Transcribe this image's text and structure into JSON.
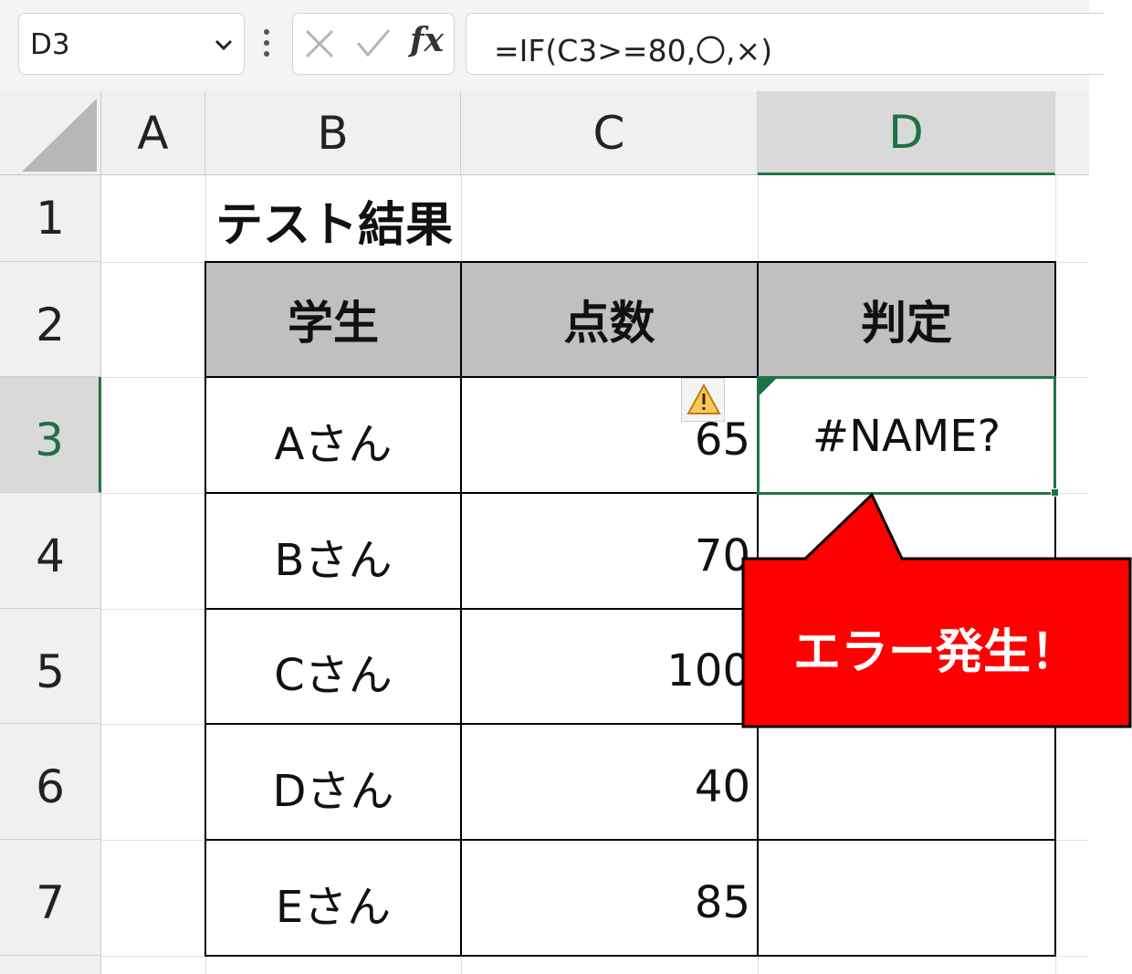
{
  "formula_bar": {
    "name_box": "D3",
    "cancel_icon": "cancel-icon",
    "enter_icon": "enter-icon",
    "fx_label": "fx",
    "formula": "=IF(C3>=80,〇,×)"
  },
  "columns": [
    "A",
    "B",
    "C",
    "D"
  ],
  "selected_column": "D",
  "rows": [
    "1",
    "2",
    "3",
    "4",
    "5",
    "6",
    "7"
  ],
  "selected_row": "3",
  "sheet": {
    "title": "テスト結果",
    "headers": [
      "学生",
      "点数",
      "判定"
    ],
    "records": [
      {
        "student": "Aさん",
        "score": "65",
        "result": "#NAME?"
      },
      {
        "student": "Bさん",
        "score": "70",
        "result": ""
      },
      {
        "student": "Cさん",
        "score": "100",
        "result": ""
      },
      {
        "student": "Dさん",
        "score": "40",
        "result": ""
      },
      {
        "student": "Eさん",
        "score": "85",
        "result": ""
      }
    ]
  },
  "error_indicator_icon": "warning-icon",
  "callout": {
    "text": "エラー発生！",
    "color": "#ff0000"
  },
  "colors": {
    "selection": "#217346",
    "header_fill": "#c0c0c0",
    "header_bg": "#f0f0f0"
  }
}
